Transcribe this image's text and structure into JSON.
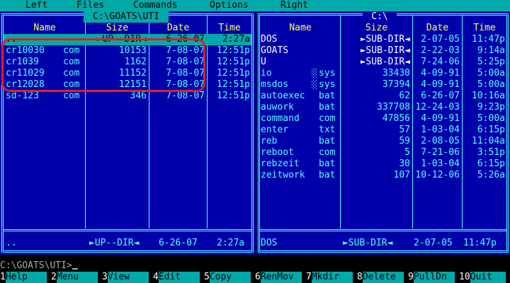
{
  "menu": [
    "Left",
    "Files",
    "Commands",
    "Options",
    "Right"
  ],
  "left_panel": {
    "path": "C:\\GOATS\\UTI",
    "headers": [
      "Name",
      "Size",
      "Date",
      "Time"
    ],
    "rows": [
      {
        "name": "..",
        "ext": "",
        "size": "►UP--DIR◄",
        "date": "6-26-07",
        "time": "2:27a"
      },
      {
        "name": "cr10030",
        "ext": "com",
        "size": "10153",
        "date": "7-08-07",
        "time": "12:51p"
      },
      {
        "name": "cr1039",
        "ext": "com",
        "size": "1162",
        "date": "7-08-07",
        "time": "12:51p"
      },
      {
        "name": "cr11029",
        "ext": "com",
        "size": "11152",
        "date": "7-08-07",
        "time": "12:51p"
      },
      {
        "name": "cr12028",
        "ext": "com",
        "size": "12151",
        "date": "7-08-07",
        "time": "12:51p"
      },
      {
        "name": "sd-123",
        "ext": "com",
        "size": "346",
        "date": "7-08-07",
        "time": "12:51p"
      }
    ],
    "status": {
      "name": "..",
      "size": "►UP--DIR◄",
      "date": "6-26-07",
      "time": "2:27a"
    }
  },
  "right_panel": {
    "path": "C:\\",
    "headers": [
      "Name",
      "Size",
      "Date",
      "Time"
    ],
    "rows": [
      {
        "name": "DOS",
        "ext": "",
        "size": "►SUB-DIR◄",
        "date": "2-07-05",
        "time": "11:47p",
        "hl": true
      },
      {
        "name": "GOATS",
        "ext": "",
        "size": "►SUB-DIR◄",
        "date": "2-22-03",
        "time": "9:14a",
        "hl": true
      },
      {
        "name": "U",
        "ext": "",
        "size": "►SUB-DIR◄",
        "date": "7-24-06",
        "time": "5:25p",
        "hl": true
      },
      {
        "name": "io",
        "ext": "sys",
        "size": "33430",
        "date": "4-09-91",
        "time": "5:00a",
        "hidden": true
      },
      {
        "name": "msdos",
        "ext": "sys",
        "size": "37394",
        "date": "4-09-91",
        "time": "5:00a",
        "hidden": true
      },
      {
        "name": "autoexec",
        "ext": "bat",
        "size": "62",
        "date": "6-26-07",
        "time": "10:16a"
      },
      {
        "name": "auwork",
        "ext": "bat",
        "size": "337708",
        "date": "12-24-03",
        "time": "9:23p"
      },
      {
        "name": "command",
        "ext": "com",
        "size": "47856",
        "date": "4-09-91",
        "time": "5:00a"
      },
      {
        "name": "enter",
        "ext": "txt",
        "size": "57",
        "date": "1-03-04",
        "time": "6:15p"
      },
      {
        "name": "reb",
        "ext": "bat",
        "size": "59",
        "date": "2-08-05",
        "time": "11:04a"
      },
      {
        "name": "reboot",
        "ext": "com",
        "size": "5",
        "date": "7-21-06",
        "time": "3:51p"
      },
      {
        "name": "rebzeit",
        "ext": "bat",
        "size": "30",
        "date": "1-03-04",
        "time": "6:15p"
      },
      {
        "name": "zeitwork",
        "ext": "bat",
        "size": "107",
        "date": "10-12-06",
        "time": "5:26a"
      }
    ],
    "status": {
      "name": "DOS",
      "size": "►SUB-DIR◄",
      "date": "2-07-05",
      "time": "11:47p"
    }
  },
  "command_line": "C:\\GOATS\\UTI>",
  "function_keys": [
    {
      "num": "1",
      "label": "Help"
    },
    {
      "num": "2",
      "label": "Menu"
    },
    {
      "num": "3",
      "label": "View"
    },
    {
      "num": "4",
      "label": "Edit"
    },
    {
      "num": "5",
      "label": "Copy"
    },
    {
      "num": "6",
      "label": "RenMov"
    },
    {
      "num": "7",
      "label": "Mkdir"
    },
    {
      "num": "8",
      "label": "Delete"
    },
    {
      "num": "9",
      "label": "PullDn"
    },
    {
      "num": "10",
      "label": "Quit"
    }
  ],
  "colors": {
    "panel_bg": "#0000aa",
    "frame": "#55ffff",
    "header_text": "#ffff55",
    "cursor_bg": "#00aaaa",
    "highlight_annotation": "#e02020"
  }
}
